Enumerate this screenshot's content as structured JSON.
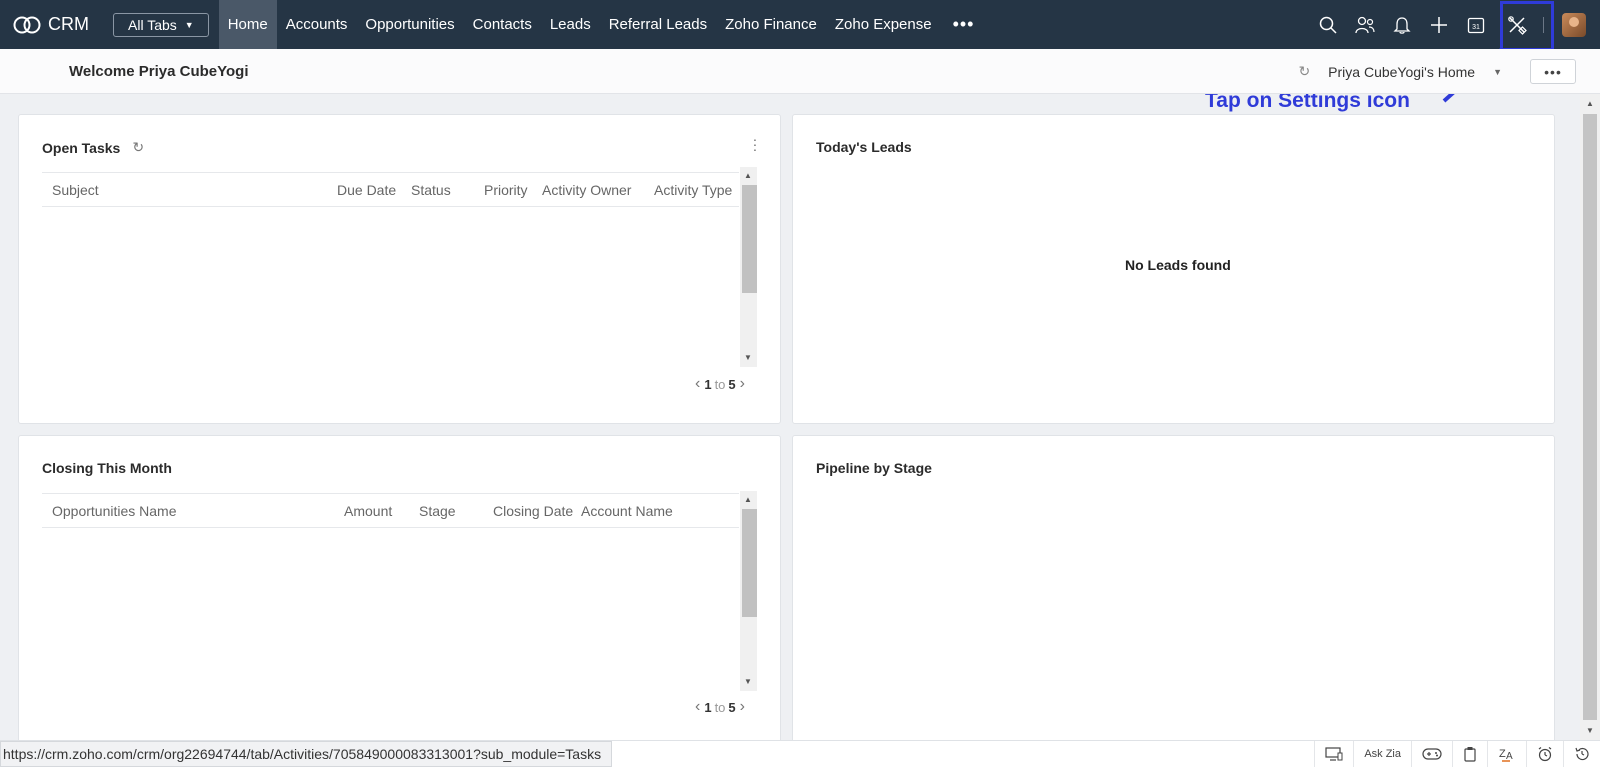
{
  "nav": {
    "logo_text": "CRM",
    "all_tabs_label": "All Tabs",
    "tabs": [
      {
        "label": "Home",
        "active": true
      },
      {
        "label": "Accounts"
      },
      {
        "label": "Opportunities"
      },
      {
        "label": "Contacts"
      },
      {
        "label": "Leads"
      },
      {
        "label": "Referral Leads"
      },
      {
        "label": "Zoho Finance"
      },
      {
        "label": "Zoho Expense"
      }
    ],
    "more_label": "•••",
    "icons": [
      "search-icon",
      "contacts-icon",
      "bell-icon",
      "plus-icon",
      "calendar-icon",
      "settings-icon",
      "avatar"
    ],
    "calendar_day": "31"
  },
  "header": {
    "welcome": "Welcome Priya CubeYogi",
    "home_view": "Priya CubeYogi's Home",
    "more_label": "•••"
  },
  "annotation": {
    "text": "Tap on Settings icon",
    "color": "#2f3bd8"
  },
  "open_tasks": {
    "title": "Open Tasks",
    "columns": [
      "Subject",
      "Due Date",
      "Status",
      "Priority",
      "Activity Owner",
      "Activity Type"
    ],
    "rows": [],
    "pager": {
      "from": "1",
      "to_label": "to",
      "to": "5"
    }
  },
  "todays_leads": {
    "title": "Today's Leads",
    "empty_message": "No Leads found"
  },
  "closing_this_month": {
    "title": "Closing This Month",
    "columns": [
      "Opportunities Name",
      "Amount",
      "Stage",
      "Closing Date",
      "Account Name"
    ],
    "rows": [],
    "pager": {
      "from": "1",
      "to_label": "to",
      "to": "5"
    }
  },
  "pipeline": {
    "title": "Pipeline by Stage"
  },
  "status_bar": {
    "url": "https://crm.zoho.com/crm/org22694744/tab/Activities/705849000083313001?sub_module=Tasks",
    "ask_zia": "Ask Zia",
    "icons": [
      "desktop-icon",
      "gamepad-icon",
      "clipboard-icon",
      "translate-icon",
      "alarm-icon",
      "history-icon"
    ]
  },
  "colors": {
    "nav_bg": "#253545",
    "nav_active": "#4a5868",
    "page_bg": "#eef0f3"
  }
}
